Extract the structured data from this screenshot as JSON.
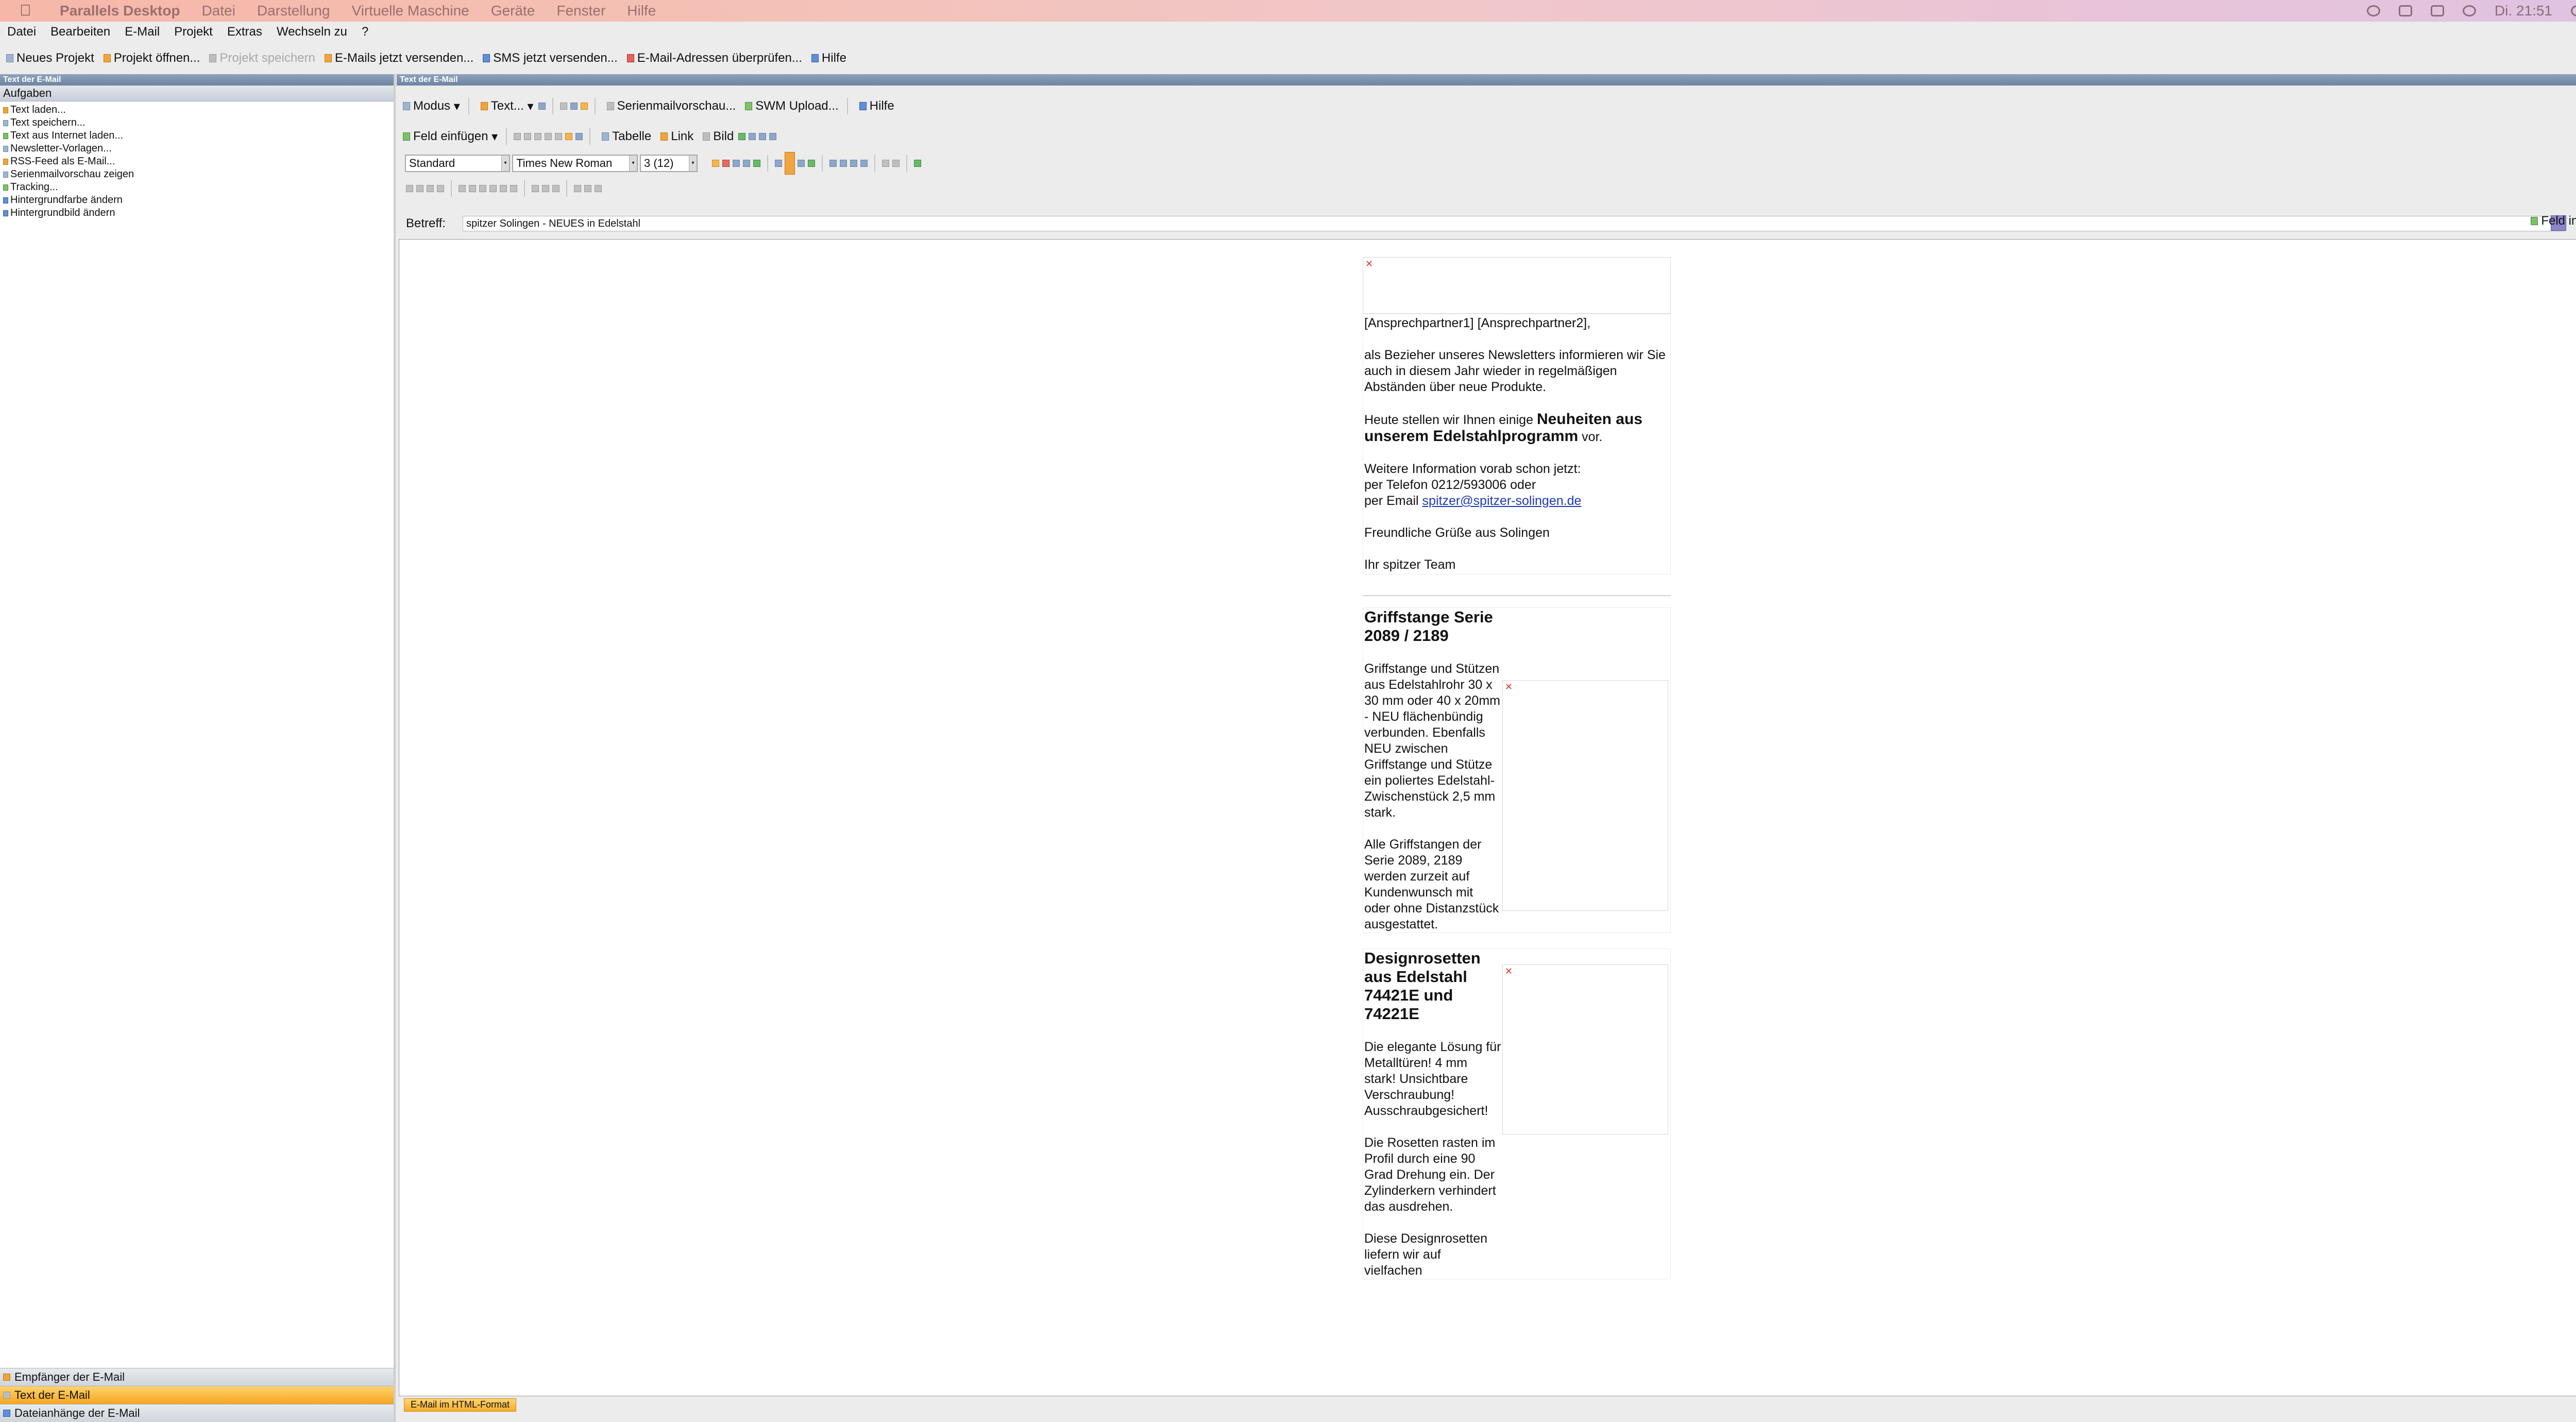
{
  "mac_menubar": {
    "app_name": "Parallels Desktop",
    "items": [
      "Datei",
      "Darstellung",
      "Virtuelle Maschine",
      "Geräte",
      "Fenster",
      "Hilfe"
    ],
    "clock": "Di. 21:51"
  },
  "app_menu": {
    "items": [
      "Datei",
      "Bearbeiten",
      "E-Mail",
      "Projekt",
      "Extras",
      "Wechseln zu",
      "?"
    ]
  },
  "toolbar": {
    "new_project": "Neues Projekt",
    "open_project": "Projekt öffnen...",
    "save_project": "Projekt speichern",
    "send_emails": "E-Mails jetzt versenden...",
    "send_sms": "SMS jetzt versenden...",
    "check_addresses": "E-Mail-Adressen überprüfen...",
    "help": "Hilfe"
  },
  "left_panel": {
    "title": "Text der E-Mail",
    "group_header": "Aufgaben",
    "tasks": [
      "Text laden...",
      "Text speichern...",
      "Text aus Internet laden...",
      "Newsletter-Vorlagen...",
      "RSS-Feed als E-Mail...",
      "Serienmailvorschau zeigen",
      "Tracking...",
      "Hintergrundfarbe ändern",
      "Hintergrundbild ändern"
    ],
    "bottom_tabs": [
      "Empfänger der E-Mail",
      "Text der E-Mail",
      "Dateianhänge der E-Mail"
    ]
  },
  "right_panel": {
    "title": "Text der E-Mail",
    "toolbar1": {
      "modus": "Modus",
      "text": "Text...",
      "preview": "Serienmailvorschau...",
      "swm_upload": "SWM Upload...",
      "help": "Hilfe"
    },
    "toolbar2": {
      "insert_field": "Feld einfügen",
      "table": "Tabelle",
      "link": "Link",
      "image": "Bild"
    },
    "format": {
      "style": "Standard",
      "font": "Times New Roman",
      "size": "3 (12)"
    },
    "subject_label": "Betreff:",
    "subject_value": "spitzer Solingen - NEUES in Edelstahl",
    "field_in_subject": "Feld in Betreff"
  },
  "email": {
    "greeting": "[Ansprechpartner1] [Ansprechpartner2],",
    "intro": "als Bezieher unseres Newsletters informieren wir Sie auch in diesem Jahr wieder in regelmäßigen Abständen über neue Produkte.",
    "heute_prefix": "Heute stellen wir Ihnen einige",
    "heute_bold": "Neuheiten aus unserem Edelstahlprogramm",
    "heute_suffix": "vor.",
    "info_line1": "Weitere Information vorab schon jetzt:",
    "info_line2": "per Telefon 0212/593006 oder",
    "info_line3_prefix": "per Email",
    "info_email": "spitzer@spitzer-solingen.de",
    "closing": "Freundliche Grüße aus Solingen",
    "signature": "Ihr spitzer Team",
    "product1": {
      "title": "Griffstange Serie 2089 / 2189",
      "body": "Griffstange und Stützen aus Edelstahlrohr 30 x 30 mm oder 40 x 20mm - NEU flächenbündig verbunden. Ebenfalls NEU zwischen Griffstange und Stütze ein poliertes Edelstahl-Zwischenstück 2,5 mm stark.",
      "body2": "Alle Griffstangen der Serie 2089, 2189 werden zurzeit auf Kundenwunsch mit oder ohne Distanzstück ausgestattet."
    },
    "product2": {
      "title": "Designrosetten aus Edelstahl 74421E und 74221E",
      "body": "Die elegante Lösung für Metalltüren! 4 mm stark! Unsichtbare Verschraubung! Ausschraubgesichert!",
      "body2": "Die Rosetten rasten im Profil durch eine 90 Grad Drehung ein. Der Zylinderkern verhindert das ausdrehen.",
      "body3": "Diese Designrosetten liefern wir auf vielfachen"
    }
  },
  "status": {
    "format_tab": "E-Mail im HTML-Format"
  },
  "colors": {
    "accent_orange": "#f4a620",
    "header_blue": "#7a8eab",
    "link_blue": "#1f3ab6"
  }
}
